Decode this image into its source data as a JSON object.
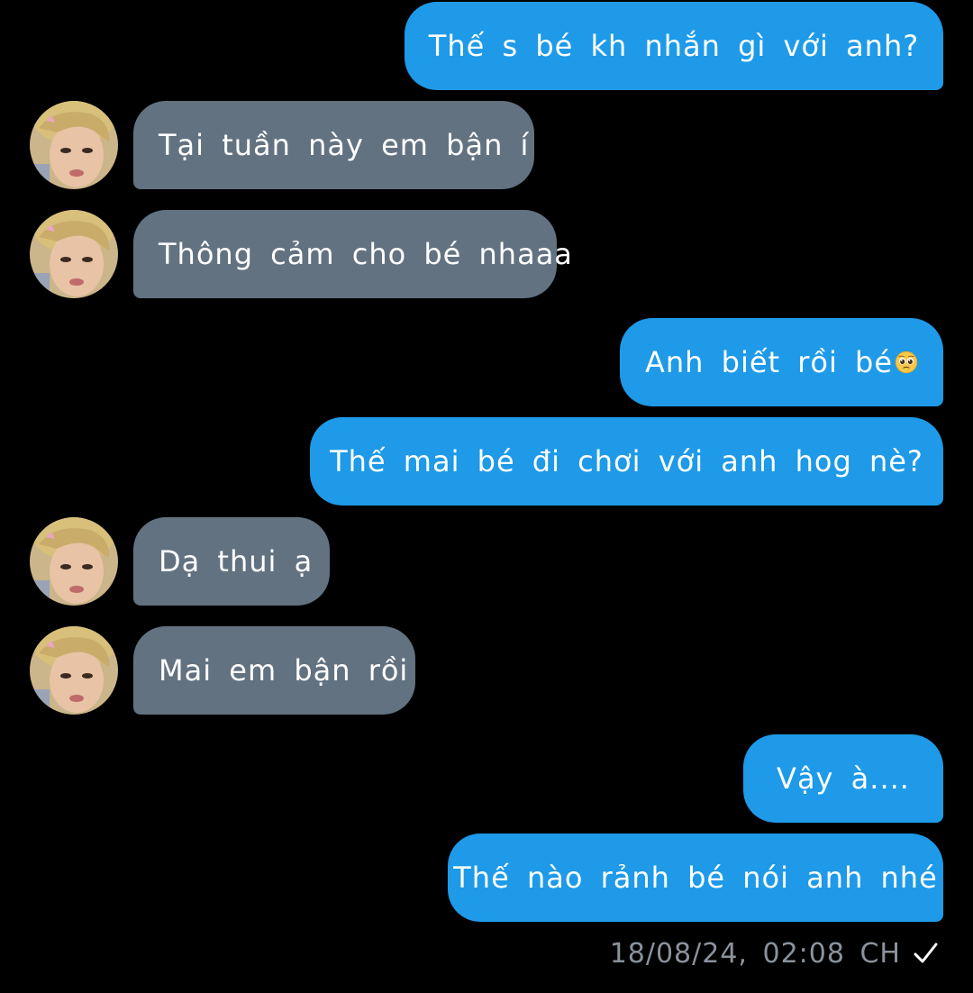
{
  "chat": {
    "messages": [
      {
        "from": "me",
        "text": "Thế s bé kh nhắn gì với anh?"
      },
      {
        "from": "them",
        "text": "Tại tuần này em bận í"
      },
      {
        "from": "them",
        "text": "Thông cảm cho bé nhaaa"
      },
      {
        "from": "me",
        "text": "Anh biết rồi bé",
        "emoji": "pleading-face"
      },
      {
        "from": "me",
        "text": "Thế mai bé đi chơi với anh hog nè?"
      },
      {
        "from": "them",
        "text": "Dạ thui ạ"
      },
      {
        "from": "them",
        "text": "Mai em bận rồi"
      },
      {
        "from": "me",
        "text": "Vậy à...."
      },
      {
        "from": "me",
        "text": "Thế nào rảnh bé nói anh nhé"
      }
    ],
    "timestamp": "18/08/24, 02:08 CH",
    "read_status_icon": "checkmark-icon"
  },
  "colors": {
    "background": "#000000",
    "sent_bubble": "#1e9ae8",
    "received_bubble": "#627281",
    "text": "#ffffff",
    "meta_text": "#8a939c"
  }
}
